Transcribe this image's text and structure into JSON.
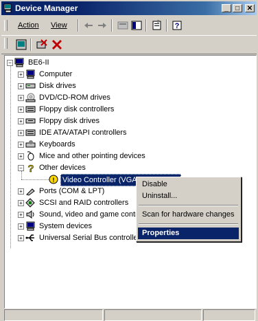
{
  "window": {
    "title": "Device Manager"
  },
  "title_buttons": {
    "minimize": "_",
    "maximize": "□",
    "close": "✕"
  },
  "menu": [
    {
      "label": "Action"
    },
    {
      "label": "View"
    }
  ],
  "tree": {
    "root": "BE6-II",
    "items": [
      {
        "label": "Computer",
        "icon": "computer-icon"
      },
      {
        "label": "Disk drives",
        "icon": "disk-drive-icon"
      },
      {
        "label": "DVD/CD-ROM drives",
        "icon": "cdrom-icon"
      },
      {
        "label": "Floppy disk controllers",
        "icon": "controller-icon"
      },
      {
        "label": "Floppy disk drives",
        "icon": "floppy-icon"
      },
      {
        "label": "IDE ATA/ATAPI controllers",
        "icon": "controller-icon"
      },
      {
        "label": "Keyboards",
        "icon": "keyboard-icon"
      },
      {
        "label": "Mice and other pointing devices",
        "icon": "mouse-icon"
      },
      {
        "label": "Other devices",
        "icon": "question-icon"
      },
      {
        "label": "Video Controller (VGA Compatible)",
        "icon": "warning-device-icon"
      },
      {
        "label": "Ports (COM & LPT)",
        "icon": "port-icon"
      },
      {
        "label": "SCSI and RAID controllers",
        "icon": "scsi-icon"
      },
      {
        "label": "Sound, video and game controllers",
        "icon": "sound-icon"
      },
      {
        "label": "System devices",
        "icon": "system-icon"
      },
      {
        "label": "Universal Serial Bus controllers",
        "icon": "usb-icon"
      }
    ]
  },
  "context_menu": {
    "items": [
      {
        "label": "Disable"
      },
      {
        "label": "Uninstall..."
      },
      {
        "label": "Scan for hardware changes"
      },
      {
        "label": "Properties"
      }
    ]
  }
}
